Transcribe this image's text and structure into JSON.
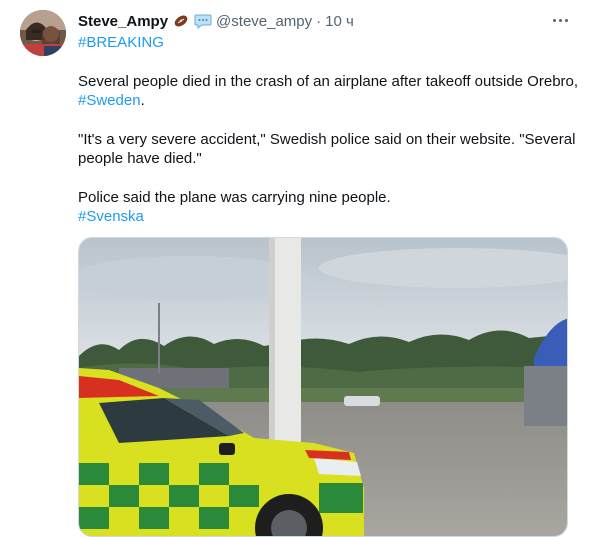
{
  "tweet": {
    "display_name": "Steve_Ampy",
    "handle": "@steve_ampy",
    "separator": "·",
    "timestamp": "10 ч",
    "hashtag_breaking": "#BREAKING",
    "paragraph1_text": "Several people died in the crash of an airplane after takeoff outside Orebro,",
    "hashtag_sweden": "#Sweden",
    "paragraph1_end": ".",
    "paragraph2_line1": "\"It's a very severe accident,\" Swedish police said on their website. \"Several",
    "paragraph2_line2": "people have died.\"",
    "paragraph3_text": "Police said the plane was carrying nine people.",
    "hashtag_svenska": "#Svenska"
  },
  "icons": {
    "badge_football": "football-icon",
    "badge_speech": "speech-bubble-icon",
    "more": "more-options-icon"
  },
  "colors": {
    "text": "#0f1419",
    "secondary": "#536471",
    "link": "#1d9bf0",
    "ambulance_yellow": "#d8e020",
    "ambulance_green": "#2a8a3a",
    "ambulance_red": "#d83020"
  }
}
